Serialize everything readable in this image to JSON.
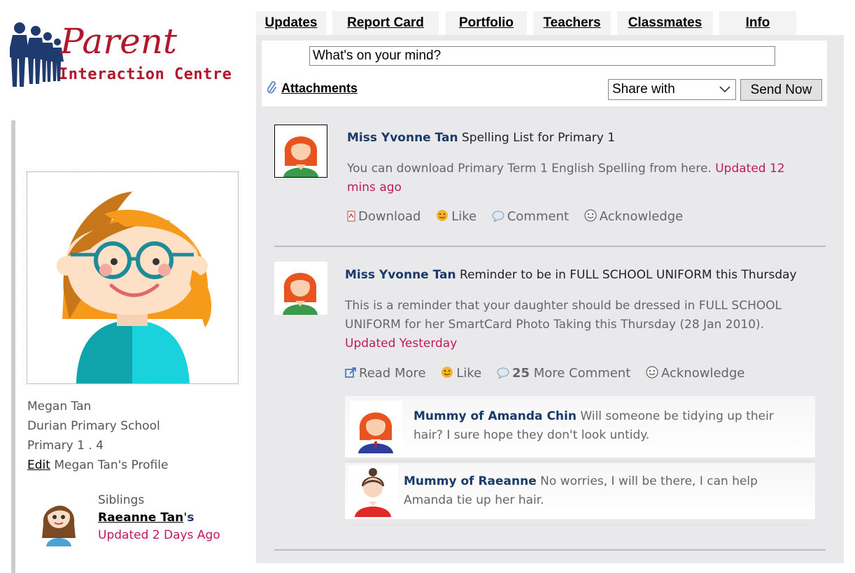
{
  "logo": {
    "line1": "Parent",
    "line2": "Interaction Centre"
  },
  "tabs": [
    {
      "label": "Updates"
    },
    {
      "label": "Report Card"
    },
    {
      "label": "Portfolio"
    },
    {
      "label": "Teachers"
    },
    {
      "label": "Classmates"
    },
    {
      "label": "Info"
    }
  ],
  "composer": {
    "status_value": "What's on your mind?",
    "attachments_label": "Attachments",
    "share_with": "Share with",
    "send_label": "Send Now"
  },
  "profile": {
    "name": "Megan Tan",
    "school": "Durian Primary School",
    "class": "Primary 1 . 4",
    "edit_label": "Edit",
    "edit_suffix": "Megan Tan's Profile"
  },
  "siblings": {
    "heading": "Siblings",
    "name": "Raeanne Tan",
    "suffix": "'s",
    "updated": "Updated 2 Days Ago"
  },
  "posts": [
    {
      "author": "Miss Yvonne Tan",
      "title": "Spelling List for Primary 1",
      "body": "You can download Primary Term 1 English Spelling from here.",
      "updated": "Updated 12 mins ago",
      "actions": {
        "primary": "Download",
        "like": "Like",
        "comment": "Comment",
        "ack": "Acknowledge"
      }
    },
    {
      "author": "Miss Yvonne Tan",
      "title": "Reminder to be in FULL SCHOOL UNIFORM this Thursday",
      "body": "This is a reminder that your daughter should be dressed in FULL SCHOOL UNIFORM for her SmartCard Photo Taking this Thursday (28 Jan 2010).",
      "updated": "Updated Yesterday",
      "actions": {
        "primary": "Read More",
        "like": "Like",
        "comment_count": "25",
        "comment": "More Comment",
        "ack": "Acknowledge"
      },
      "comments": [
        {
          "author": "Mummy of Amanda Chin",
          "text": "Will someone be tidying up their hair? I sure hope they don't look untidy."
        },
        {
          "author": "Mummy of Raeanne",
          "text": "No worries, I will be there, I can help Amanda tie up her hair."
        }
      ]
    }
  ],
  "colors": {
    "author": "#1a3a6a",
    "updated": "#c2185b",
    "panel": "#e9e9ec",
    "logo_red": "#b0182b",
    "logo_navy": "#1e3a6e"
  }
}
